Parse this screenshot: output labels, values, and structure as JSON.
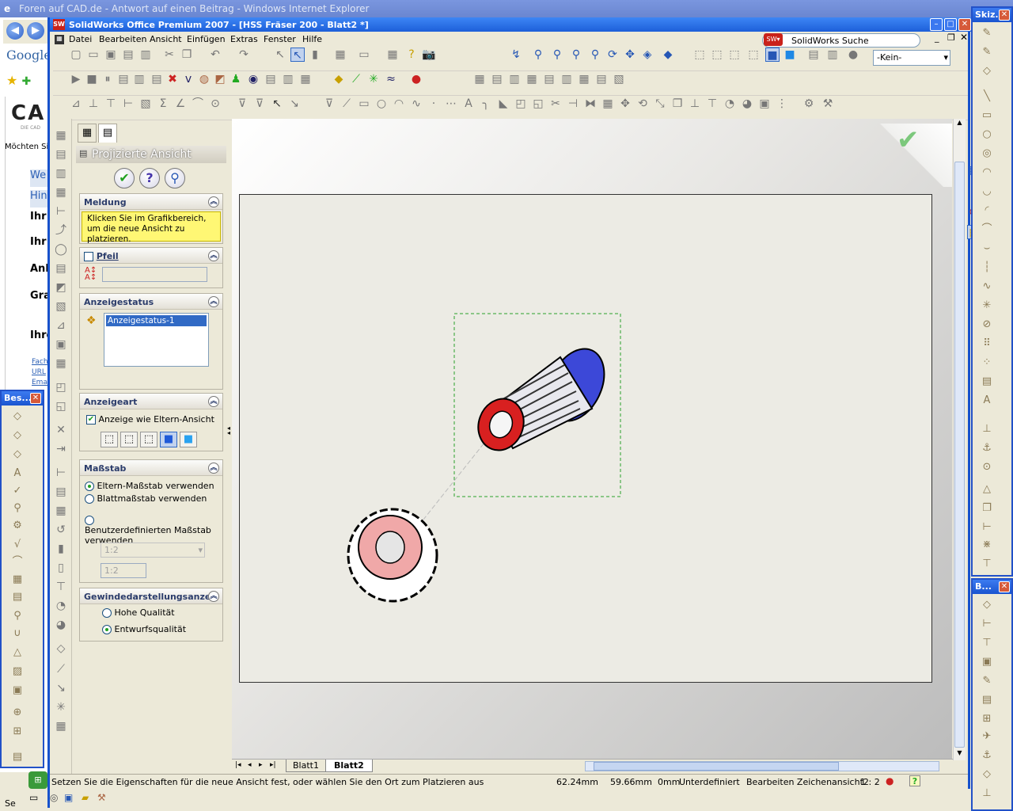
{
  "ie": {
    "title": "Foren auf CAD.de - Antwort auf einen Beitrag - Windows Internet Explorer",
    "google": "Google",
    "logo": "CA",
    "logo_sub": "DIE CAD",
    "moechten": "Möchten Si",
    "items": [
      "We",
      "Hin",
      "Ihr",
      "Ihr",
      "Anl",
      "Gra",
      "Ihre"
    ],
    "links": [
      "Fach",
      "URL",
      "Ema"
    ],
    "taskbar_left": "Se"
  },
  "floating_left": {
    "title": "Bes...",
    "close": "✕"
  },
  "floating_right_top": {
    "title": "Skiz...",
    "close": "✕"
  },
  "floating_right_bottom": {
    "title": "B...",
    "close": "✕"
  },
  "sw": {
    "title": "SolidWorks Office Premium 2007 - [HSS Fräser 200 - Blatt2 *]",
    "logo": "SW",
    "menu": [
      "Datei",
      "Bearbeiten",
      "Ansicht",
      "Einfügen",
      "Extras",
      "Fenster",
      "Hilfe"
    ],
    "search": "SolidWorks Suche",
    "layer_select": "-Kein-"
  },
  "pm": {
    "heading": "Projizierte Ansicht",
    "ok": "✔",
    "help": "?",
    "pin": "⚲",
    "meldung": {
      "title": "Meldung",
      "message": "Klicken Sie im Grafikbereich, um die neue Ansicht zu platzieren."
    },
    "pfeil": {
      "title": "Pfeil",
      "icon": "A"
    },
    "anzeigestatus": {
      "title": "Anzeigestatus",
      "item": "Anzeigestatus-1"
    },
    "anzeigeart": {
      "title": "Anzeigeart",
      "checkbox_label": "Anzeige wie Eltern-Ansicht"
    },
    "massstab": {
      "title": "Maßstab",
      "opt1": "Eltern-Maßstab verwenden",
      "opt2": "Blattmaßstab verwenden",
      "opt3a": "Benutzerdefinierten Maßstab",
      "opt3b": "verwenden",
      "select_value": "1:2",
      "input_value": "1:2"
    },
    "gewinde": {
      "title": "Gewindedarstellungsanzei",
      "opt1": "Hohe Qualität",
      "opt2": "Entwurfsqualität"
    }
  },
  "sheet_tabs": [
    "Blatt1",
    "Blatt2"
  ],
  "status": {
    "message": "Setzen Sie die Eigenschaften für die neue Ansicht fest, oder wählen Sie den Ort zum Platzieren aus",
    "x": "62.24mm",
    "y": "59.66mm",
    "z": "0mm",
    "state": "Unterdefiniert",
    "mode": "Bearbeiten Zeichenansicht2",
    "scale": "1 : 2",
    "help": "?"
  },
  "colors": {
    "accent_red": "#d82020",
    "accent_blue": "#2a3fd8",
    "title_blue": "#1d5fd9"
  }
}
